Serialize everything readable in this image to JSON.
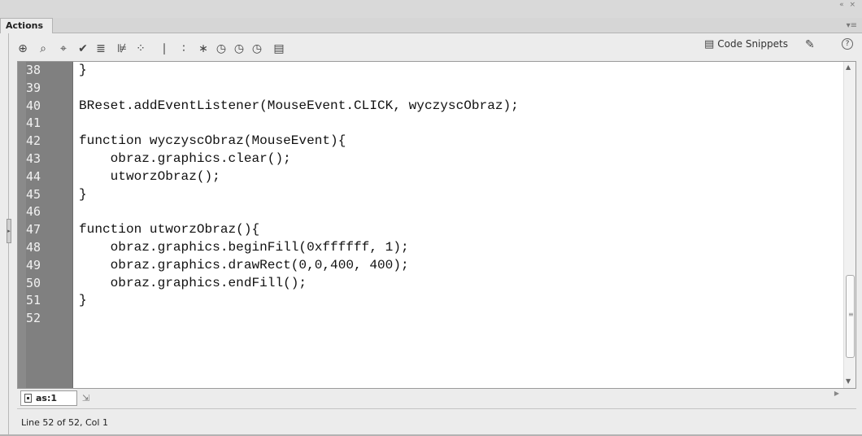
{
  "window": {
    "panel_title": "Actions",
    "top_controls": "« ×",
    "panel_menu": "▾≡"
  },
  "toolbar": {
    "icons": [
      "add-statement-icon",
      "find-icon",
      "target-icon",
      "check-syntax-icon",
      "auto-format-icon",
      "code-hint-icon",
      "debug-options-icon",
      "collapse-braces-icon",
      "collapse-selection-icon",
      "expand-all-icon",
      "apply-block-comment-icon",
      "apply-line-comment-icon",
      "remove-comment-icon",
      "show-hide-toolbox-icon"
    ],
    "glyphs": [
      "⊕",
      "⌕",
      "⌖",
      "✔",
      "≣",
      "⊯",
      "⁘",
      "∣",
      "∶",
      "∗",
      "◷",
      "◷",
      "◷",
      "▤"
    ],
    "code_snippets_label": "Code Snippets"
  },
  "editor": {
    "lines": [
      {
        "n": "38",
        "code": "}"
      },
      {
        "n": "39",
        "code": ""
      },
      {
        "n": "40",
        "code": "BReset.addEventListener(MouseEvent.CLICK, wyczyscObraz);"
      },
      {
        "n": "41",
        "code": ""
      },
      {
        "n": "42",
        "code": "function wyczyscObraz(MouseEvent){"
      },
      {
        "n": "43",
        "code": "    obraz.graphics.clear();"
      },
      {
        "n": "44",
        "code": "    utworzObraz();"
      },
      {
        "n": "45",
        "code": "}"
      },
      {
        "n": "46",
        "code": ""
      },
      {
        "n": "47",
        "code": "function utworzObraz(){"
      },
      {
        "n": "48",
        "code": "    obraz.graphics.beginFill(0xffffff, 1);"
      },
      {
        "n": "49",
        "code": "    obraz.graphics.drawRect(0,0,400, 400);"
      },
      {
        "n": "50",
        "code": "    obraz.graphics.endFill();"
      },
      {
        "n": "51",
        "code": "}"
      },
      {
        "n": "52",
        "code": ""
      }
    ]
  },
  "script_tab": {
    "label": "as:1"
  },
  "status": {
    "text": "Line 52 of 52, Col 1"
  },
  "colors": {
    "gutter": "#808080",
    "line_numbers": "#f1f1f1",
    "code_text": "#111111",
    "panel_bg": "#ececec"
  }
}
